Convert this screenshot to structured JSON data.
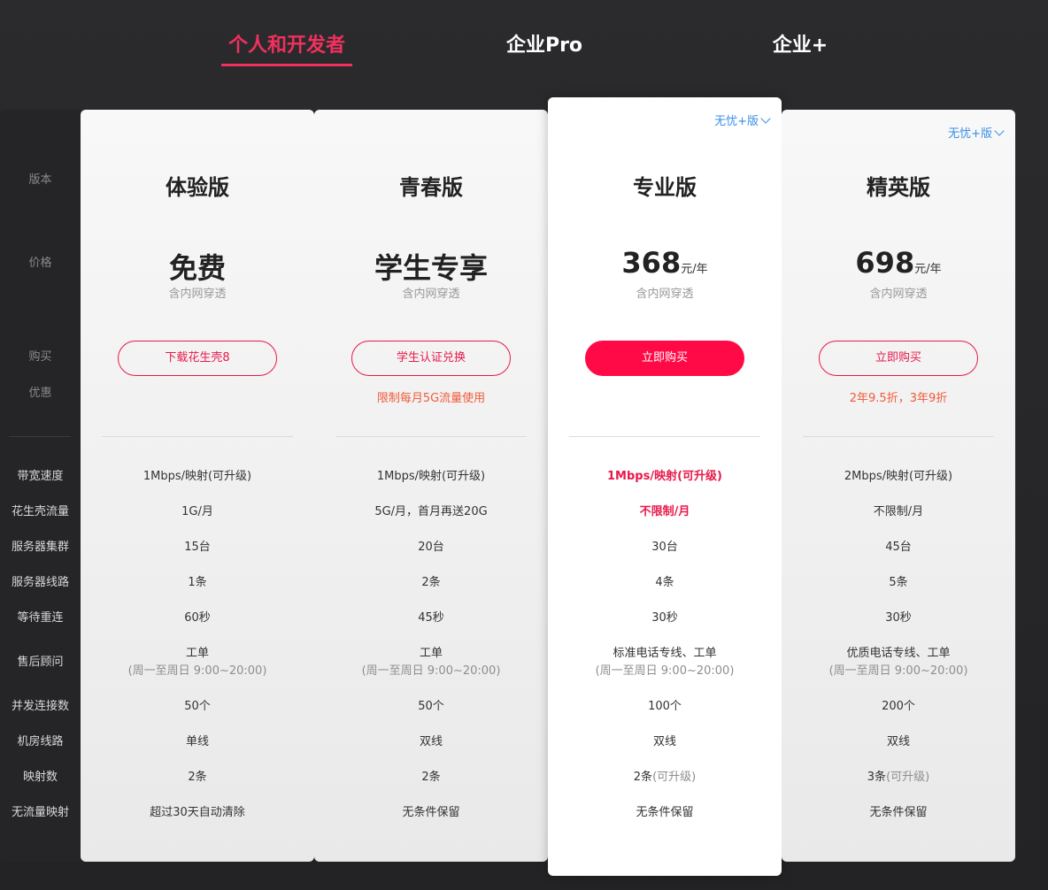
{
  "tabs": [
    {
      "label": "个人和开发者",
      "active": true
    },
    {
      "label": "企业Pro",
      "active": false
    },
    {
      "label": "企业+",
      "active": false
    }
  ],
  "labels": {
    "version": "版本",
    "price": "价格",
    "buy": "购买",
    "discount": "优惠",
    "rows": [
      "带宽速度",
      "花生壳流量",
      "服务器集群",
      "服务器线路",
      "等待重连",
      "售后顾问",
      "并发连接数",
      "机房线路",
      "映射数",
      "无流量映射"
    ]
  },
  "plans": [
    {
      "name": "体验版",
      "price": "免费",
      "price_unit": "",
      "price_note": "含内网穿透",
      "button": "下载花生壳8",
      "promo": "",
      "upsell": "",
      "rows": [
        "1Mbps/映射(可升级)",
        "1G/月",
        "15台",
        "1条",
        "60秒",
        "工单",
        "50个",
        "单线",
        "2条",
        "超过30天自动清除"
      ],
      "support_hours": "(周一至周日 9:00~20:00)"
    },
    {
      "name": "青春版",
      "price": "学生专享",
      "price_unit": "",
      "price_note": "含内网穿透",
      "button": "学生认证兑换",
      "promo": "限制每月5G流量使用",
      "upsell": "",
      "rows": [
        "1Mbps/映射(可升级)",
        "5G/月，首月再送20G",
        "20台",
        "2条",
        "45秒",
        "工单",
        "50个",
        "双线",
        "2条",
        "无条件保留"
      ],
      "support_hours": "(周一至周日 9:00~20:00)"
    },
    {
      "name": "专业版",
      "price": "368",
      "price_unit": "元/年",
      "price_note": "含内网穿透",
      "button": "立即购买",
      "promo": "",
      "upsell": "无忧+版",
      "rows": [
        "1Mbps/映射(可升级)",
        "不限制/月",
        "30台",
        "4条",
        "30秒",
        "标准电话专线、工单",
        "100个",
        "双线",
        "2条",
        "无条件保留"
      ],
      "rows_suffix_8": "(可升级)",
      "support_hours": "(周一至周日 9:00~20:00)"
    },
    {
      "name": "精英版",
      "price": "698",
      "price_unit": "元/年",
      "price_note": "含内网穿透",
      "button": "立即购买",
      "promo": "2年9.5折，3年9折",
      "upsell": "无忧+版",
      "rows": [
        "2Mbps/映射(可升级)",
        "不限制/月",
        "45台",
        "5条",
        "30秒",
        "优质电话专线、工单",
        "200个",
        "双线",
        "3条",
        "无条件保留"
      ],
      "rows_suffix_8": "(可升级)",
      "support_hours": "(周一至周日 9:00~20:00)"
    }
  ],
  "colors": {
    "accent": "#f0305e",
    "button_red": "#ff0a47",
    "promo": "#f05a3a",
    "link_blue": "#3a8ee6",
    "background": "#2b2b2d"
  }
}
